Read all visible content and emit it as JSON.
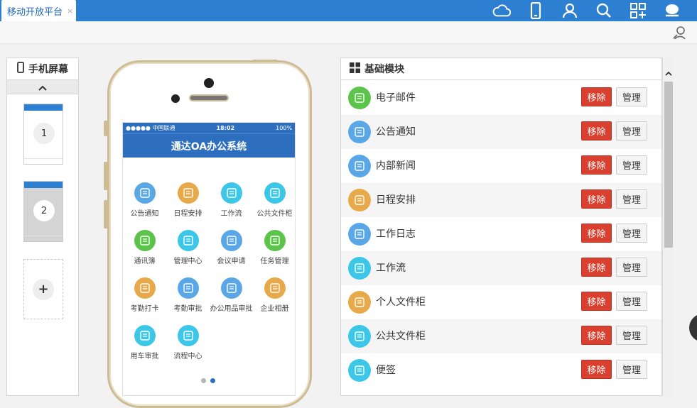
{
  "tab": {
    "label": "移动开放平台",
    "close": "×"
  },
  "top_icons": [
    "cloud-icon",
    "mobile-icon",
    "user-icon",
    "search-icon",
    "apps-icon",
    "chat-icon"
  ],
  "screens_panel": {
    "title": "手机屏幕",
    "screens": [
      {
        "number": "1"
      },
      {
        "number": "2"
      }
    ],
    "add": "+"
  },
  "phone": {
    "status": {
      "carrier": "●●●●● 中国联通",
      "time": "18:02",
      "battery": "100%"
    },
    "app_title": "通达OA办公系统",
    "apps": [
      {
        "label": "公告通知",
        "color": "#5aa7e8"
      },
      {
        "label": "日程安排",
        "color": "#e8a94a"
      },
      {
        "label": "工作流",
        "color": "#3cc6e8"
      },
      {
        "label": "公共文件柜",
        "color": "#3cc6e8"
      },
      {
        "label": "通讯簿",
        "color": "#5cc44a"
      },
      {
        "label": "管理中心",
        "color": "#3cc6e8"
      },
      {
        "label": "会议申请",
        "color": "#5aa7e8"
      },
      {
        "label": "任务管理",
        "color": "#5cc44a"
      },
      {
        "label": "考勤打卡",
        "color": "#e8a94a"
      },
      {
        "label": "考勤审批",
        "color": "#5aa7e8"
      },
      {
        "label": "办公用品审批",
        "color": "#5aa7e8"
      },
      {
        "label": "企业相册",
        "color": "#e8a94a"
      },
      {
        "label": "用车审批",
        "color": "#3cc6e8"
      },
      {
        "label": "流程中心",
        "color": "#3cc6e8"
      }
    ],
    "page_dots": 2,
    "active_dot": 2
  },
  "modules_panel": {
    "title": "基础模块",
    "remove_label": "移除",
    "manage_label": "管理",
    "items": [
      {
        "name": "电子邮件",
        "color": "#5cc44a",
        "icon": "mail-icon"
      },
      {
        "name": "公告通知",
        "color": "#5aa7e8",
        "icon": "megaphone-icon"
      },
      {
        "name": "内部新闻",
        "color": "#5aa7e8",
        "icon": "news-icon"
      },
      {
        "name": "日程安排",
        "color": "#e8a94a",
        "icon": "calendar-icon"
      },
      {
        "name": "工作日志",
        "color": "#5aa7e8",
        "icon": "log-icon"
      },
      {
        "name": "工作流",
        "color": "#3cc6e8",
        "icon": "workflow-icon"
      },
      {
        "name": "个人文件柜",
        "color": "#e8a94a",
        "icon": "folder-icon"
      },
      {
        "name": "公共文件柜",
        "color": "#3cc6e8",
        "icon": "cabinet-icon"
      },
      {
        "name": "便签",
        "color": "#3cc6e8",
        "icon": "note-icon"
      }
    ]
  }
}
